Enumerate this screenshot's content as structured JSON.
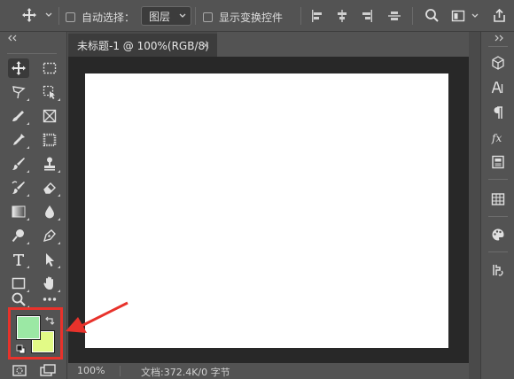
{
  "options_bar": {
    "auto_select_label": "自动选择：",
    "auto_select_value": "图层",
    "show_transform_label": "显示变换控件"
  },
  "document": {
    "tab_title": "未标题-1 @ 100%(RGB/8)",
    "tab_close": "×"
  },
  "status": {
    "zoom": "100%",
    "doc_info": "文档:372.4K/0 字节"
  },
  "colors": {
    "foreground": "#9be8a4",
    "background": "#e2fa86",
    "highlight": "#e8322b"
  },
  "left_toolbar": {
    "tools": [
      "move-tool",
      "rectangular-marquee-tool",
      "lasso-tool",
      "object-selection-tool",
      "pen-brush-tool",
      "frame-tool",
      "eyedropper-tool",
      "crop-tool",
      "brush-tool",
      "clone-stamp-tool",
      "history-brush-tool",
      "eraser-tool",
      "gradient-tool",
      "blur-tool",
      "dodge-tool",
      "pen-tool",
      "type-tool",
      "path-selection-tool",
      "rectangle-tool",
      "hand-tool",
      "zoom-tool",
      "more-tools"
    ]
  },
  "right_panel": {
    "icons": [
      "3d-cube-icon",
      "character-icon",
      "paragraph-icon",
      "fx-styles-icon",
      "properties-icon",
      "table-icon",
      "color-palette-icon",
      "paths-icon"
    ]
  }
}
